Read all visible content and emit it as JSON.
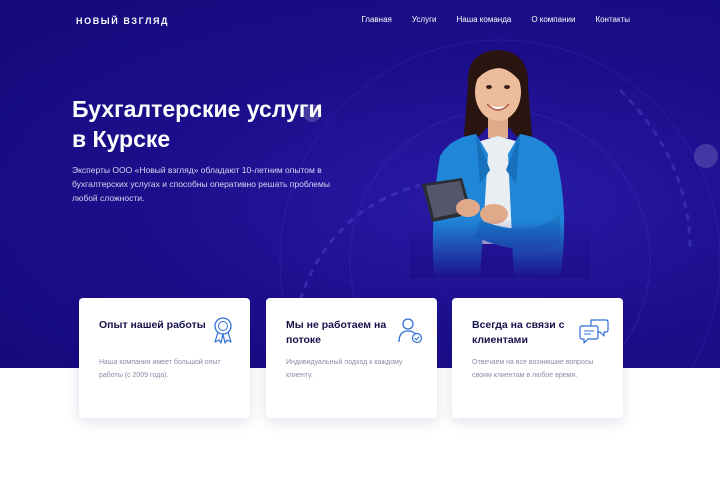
{
  "brand": {
    "logo": "НОВЫЙ ВЗГЛЯД",
    "primary_color": "#1b0e88",
    "accent_color": "#2f6fd6",
    "heading_color": "#15124a"
  },
  "nav": {
    "items": [
      {
        "label": "Главная"
      },
      {
        "label": "Услуги"
      },
      {
        "label": "Наша команда"
      },
      {
        "label": "О компании"
      },
      {
        "label": "Контакты"
      }
    ]
  },
  "hero": {
    "title_line1": "Бухгалтерские услуги",
    "title_line2": "в Курске",
    "description": "Эксперты ООО «Новый взгляд» обладают 10-летним опытом в бухгалтерских услугах и способны оперативно решать проблемы любой сложности."
  },
  "features": [
    {
      "title": "Опыт нашей работы",
      "text": "Наша компания имеет большой опыт работы (с 2009 года).",
      "icon": "award-ribbon-icon"
    },
    {
      "title": "Мы не работаем на потоке",
      "text": "Индивидуальный подход к каждому клиенту.",
      "icon": "user-check-icon"
    },
    {
      "title": "Всегда на связи с клиентами",
      "text": "Отвечаем на все возникшие вопросы своим клиентам в любое время.",
      "icon": "chat-bubbles-icon"
    }
  ]
}
